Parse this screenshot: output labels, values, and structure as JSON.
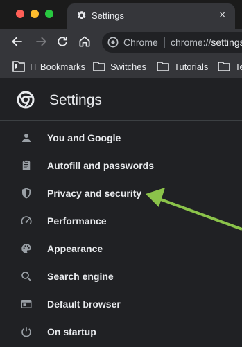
{
  "tab": {
    "title": "Settings",
    "close": "×"
  },
  "omnibox": {
    "chip": "Chrome",
    "url_scheme": "chrome://",
    "url_rest": "settings"
  },
  "bookmarks": [
    {
      "label": "IT Bookmarks",
      "icon": "bookmark-file-icon"
    },
    {
      "label": "Switches",
      "icon": "folder-icon"
    },
    {
      "label": "Tutorials",
      "icon": "folder-icon"
    },
    {
      "label": "Te",
      "icon": "folder-icon"
    }
  ],
  "settings": {
    "title": "Settings"
  },
  "nav": [
    {
      "label": "You and Google",
      "icon": "person-icon"
    },
    {
      "label": "Autofill and passwords",
      "icon": "clipboard-icon"
    },
    {
      "label": "Privacy and security",
      "icon": "shield-icon"
    },
    {
      "label": "Performance",
      "icon": "speedometer-icon"
    },
    {
      "label": "Appearance",
      "icon": "palette-icon"
    },
    {
      "label": "Search engine",
      "icon": "search-icon"
    },
    {
      "label": "Default browser",
      "icon": "browser-icon"
    },
    {
      "label": "On startup",
      "icon": "power-icon"
    }
  ],
  "colors": {
    "annotation_arrow": "#8bc34a",
    "background": "#202124",
    "text": "#e8eaed"
  }
}
